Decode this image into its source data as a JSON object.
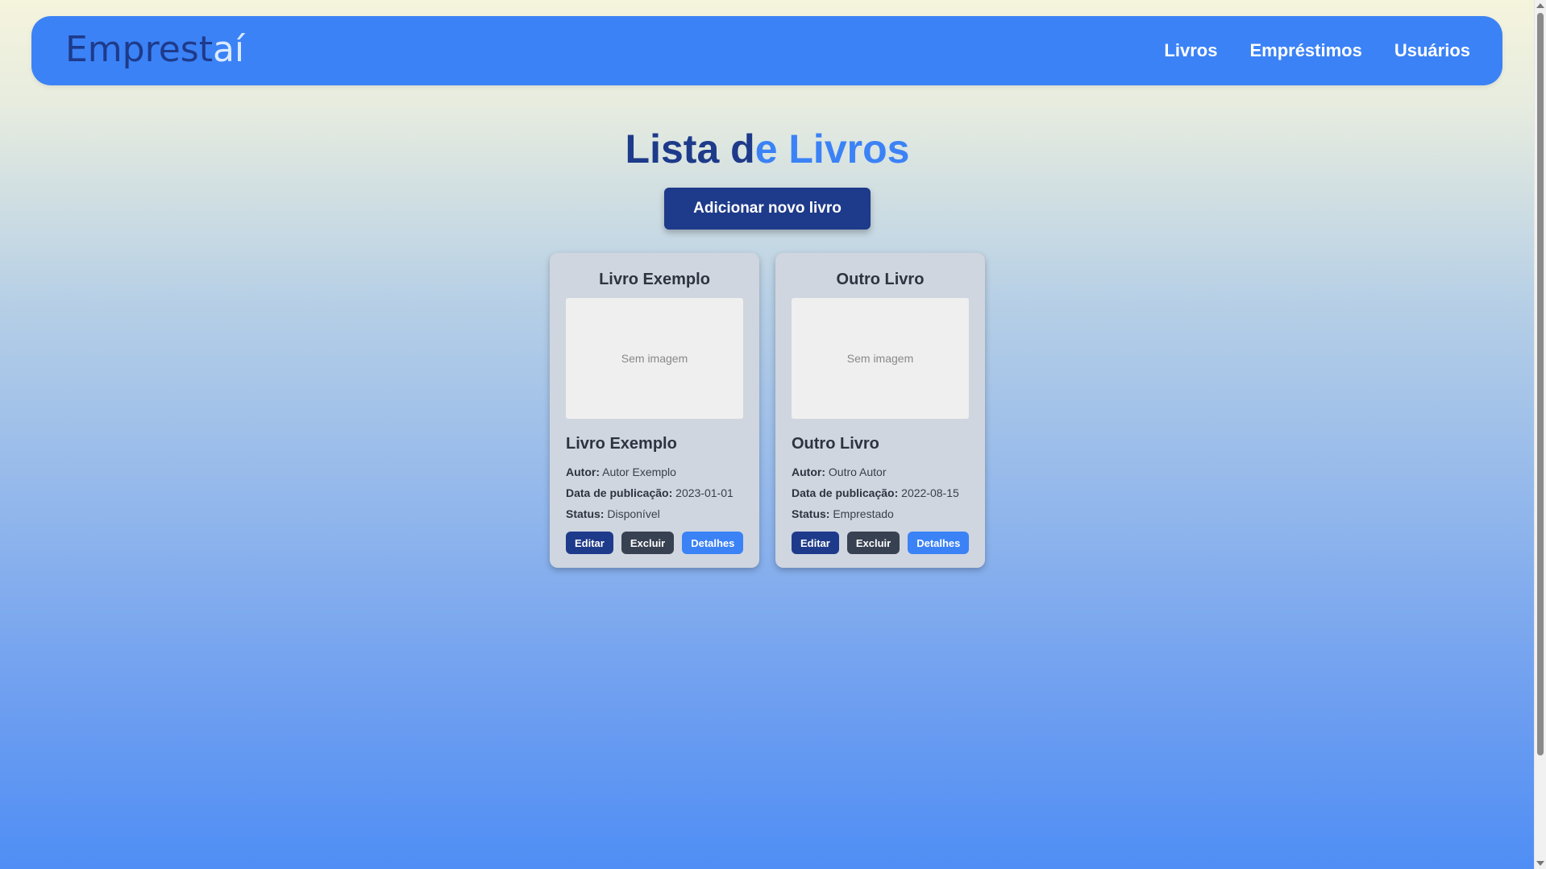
{
  "header": {
    "logo_part1": "Emprest",
    "logo_part2": "aí",
    "nav": {
      "books": "Livros",
      "loans": "Empréstimos",
      "users": "Usuários"
    }
  },
  "main": {
    "title_part1": "Lista d",
    "title_part2": "e Livros",
    "add_button": "Adicionar novo livro"
  },
  "labels": {
    "author": "Autor:",
    "published": "Data de publicação:",
    "status": "Status:",
    "no_image": "Sem imagem",
    "edit": "Editar",
    "delete": "Excluir",
    "details": "Detalhes"
  },
  "books": [
    {
      "title": "Livro Exemplo",
      "author": "Autor Exemplo",
      "published": "2023-01-01",
      "status": "Disponível"
    },
    {
      "title": "Outro Livro",
      "author": "Outro Autor",
      "published": "2022-08-15",
      "status": "Emprestado"
    }
  ],
  "colors": {
    "primary": "#3b82f6",
    "dark_blue": "#1e3a8a",
    "dark_gray": "#374151"
  }
}
